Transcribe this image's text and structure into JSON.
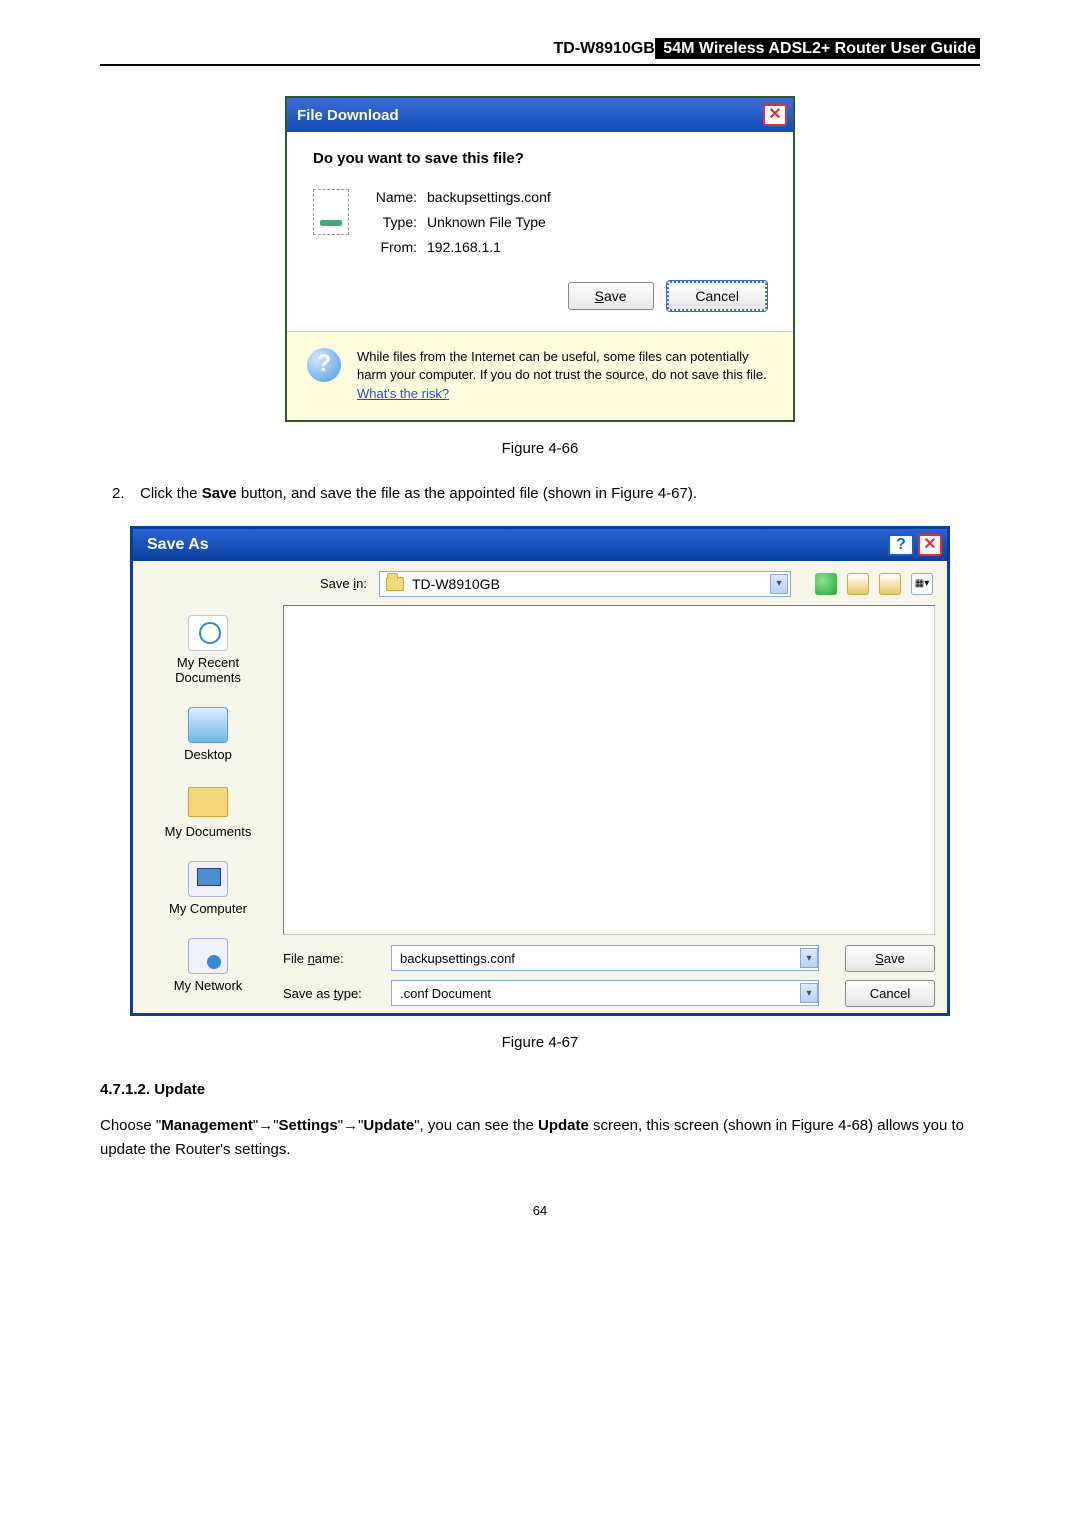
{
  "header": {
    "model": "TD-W8910GB",
    "title_suffix": " 54M  Wireless  ADSL2+  Router  User  Guide"
  },
  "dlg1": {
    "title": "File Download",
    "question": "Do you want to save this file?",
    "labels": {
      "name": "Name:",
      "type": "Type:",
      "from": "From:"
    },
    "values": {
      "name": "backupsettings.conf",
      "type": "Unknown File Type",
      "from": "192.168.1.1"
    },
    "buttons": {
      "save": "Save",
      "cancel": "Cancel"
    },
    "warning_pre": "While files from the Internet can be useful, some files can potentially harm your computer. If you do not trust the source, do not save this file. ",
    "warning_link": "What's the risk?"
  },
  "figure66": "Figure 4-66",
  "step2_pre": "Click the ",
  "step2_bold": "Save",
  "step2_post": " button, and save the file as the appointed file (shown in Figure 4-67).",
  "dlg2": {
    "title": "Save As",
    "savein_label": "Save in:",
    "savein_value": "TD-W8910GB",
    "places": {
      "recent": "My Recent\nDocuments",
      "desktop": "Desktop",
      "docs": "My Documents",
      "computer": "My Computer",
      "network": "My Network"
    },
    "filename_label": "File name:",
    "filename_value": "backupsettings.conf",
    "savetype_label": "Save as type:",
    "savetype_value": ".conf Document",
    "buttons": {
      "save": "Save",
      "cancel": "Cancel"
    }
  },
  "figure67": "Figure 4-67",
  "section": {
    "number": "4.7.1.2.  Update",
    "line1_a": "Choose \"",
    "line1_b": "Management",
    "line1_c": "\"",
    "line1_d": "\"",
    "line1_e": "Settings",
    "line1_f": "\"",
    "line1_g": "\"",
    "line1_h": "Update",
    "line1_i": "\", you can see the ",
    "line1_j": "Update",
    "line1_k": " screen, this screen (shown in Figure 4-68) allows you to update the Router's settings."
  },
  "page_number": "64"
}
